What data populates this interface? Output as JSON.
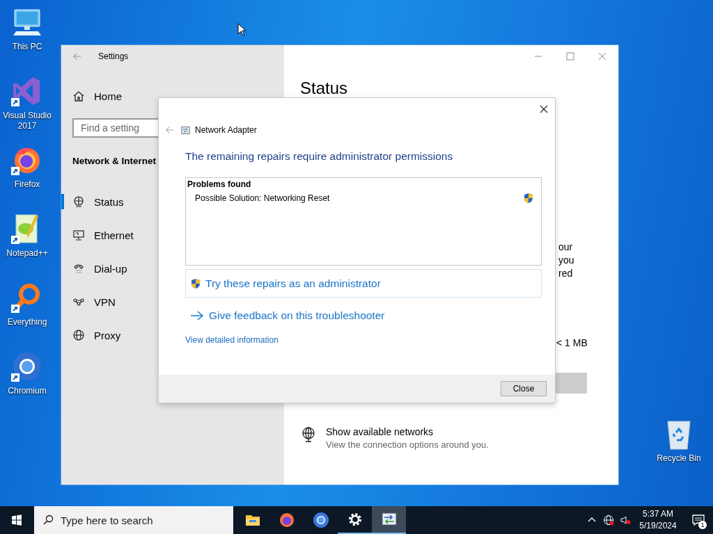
{
  "desktop_icons": [
    {
      "label": "This PC",
      "kind": "pc",
      "shortcut": false
    },
    {
      "label": "Visual Studio 2017",
      "kind": "vs",
      "shortcut": true
    },
    {
      "label": "Firefox",
      "kind": "firefox",
      "shortcut": true
    },
    {
      "label": "Notepad++",
      "kind": "notepad",
      "shortcut": true
    },
    {
      "label": "Everything",
      "kind": "everything",
      "shortcut": true
    },
    {
      "label": "Chromium",
      "kind": "chromium",
      "shortcut": true
    }
  ],
  "recycle_bin": {
    "label": "Recycle Bin"
  },
  "settings_window": {
    "title": "Settings",
    "home": "Home",
    "search": {
      "placeholder": "Find a setting"
    },
    "section": "Network & Internet",
    "nav": [
      {
        "label": "Status",
        "kind": "status",
        "selected": true
      },
      {
        "label": "Ethernet",
        "kind": "ethernet",
        "selected": false
      },
      {
        "label": "Dial-up",
        "kind": "dialup",
        "selected": false
      },
      {
        "label": "VPN",
        "kind": "vpn",
        "selected": false
      },
      {
        "label": "Proxy",
        "kind": "proxy",
        "selected": false
      }
    ],
    "heading": "Status",
    "fragments": [
      "our",
      "you",
      "red"
    ],
    "size": "< 1 MB",
    "networks": {
      "title": "Show available networks",
      "subtitle": "View the connection options around you."
    }
  },
  "dialog": {
    "title": "Network Adapter",
    "heading": "The remaining repairs require administrator permissions",
    "problems": {
      "title": "Problems found",
      "items": [
        {
          "text": "Possible Solution: Networking Reset",
          "admin": true
        }
      ]
    },
    "admin_action": "Try these repairs as an administrator",
    "feedback": "Give feedback on this troubleshooter",
    "details": "View detailed information",
    "close": "Close"
  },
  "taskbar": {
    "search_placeholder": "Type here to search",
    "apps": [
      {
        "kind": "explorer",
        "running": false,
        "active": false
      },
      {
        "kind": "firefox",
        "running": false,
        "active": false
      },
      {
        "kind": "chromium",
        "running": false,
        "active": false
      },
      {
        "kind": "settings",
        "running": true,
        "active": false
      },
      {
        "kind": "network",
        "running": true,
        "active": true
      }
    ],
    "clock": {
      "time": "5:37 AM",
      "date": "5/19/2024"
    },
    "notifications": "1"
  }
}
